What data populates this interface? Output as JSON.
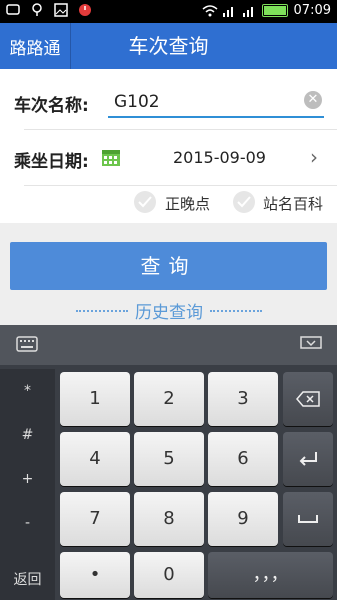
{
  "status_bar": {
    "time": "07:09"
  },
  "appbar": {
    "back_label": "路路通",
    "title": "车次查询"
  },
  "form": {
    "train_label": "车次名称:",
    "train_value": "G102",
    "date_label": "乘坐日期:",
    "date_value": "2015-09-09",
    "opt1": "正晚点",
    "opt2": "站名百科"
  },
  "query_button": "查询",
  "history_link": "历史查询",
  "keyboard": {
    "side": [
      "*",
      "#",
      "+",
      "-",
      "返回"
    ],
    "keys": [
      "1",
      "2",
      "3",
      "4",
      "5",
      "6",
      "7",
      "8",
      "9",
      "•",
      "0",
      "，，，"
    ]
  }
}
